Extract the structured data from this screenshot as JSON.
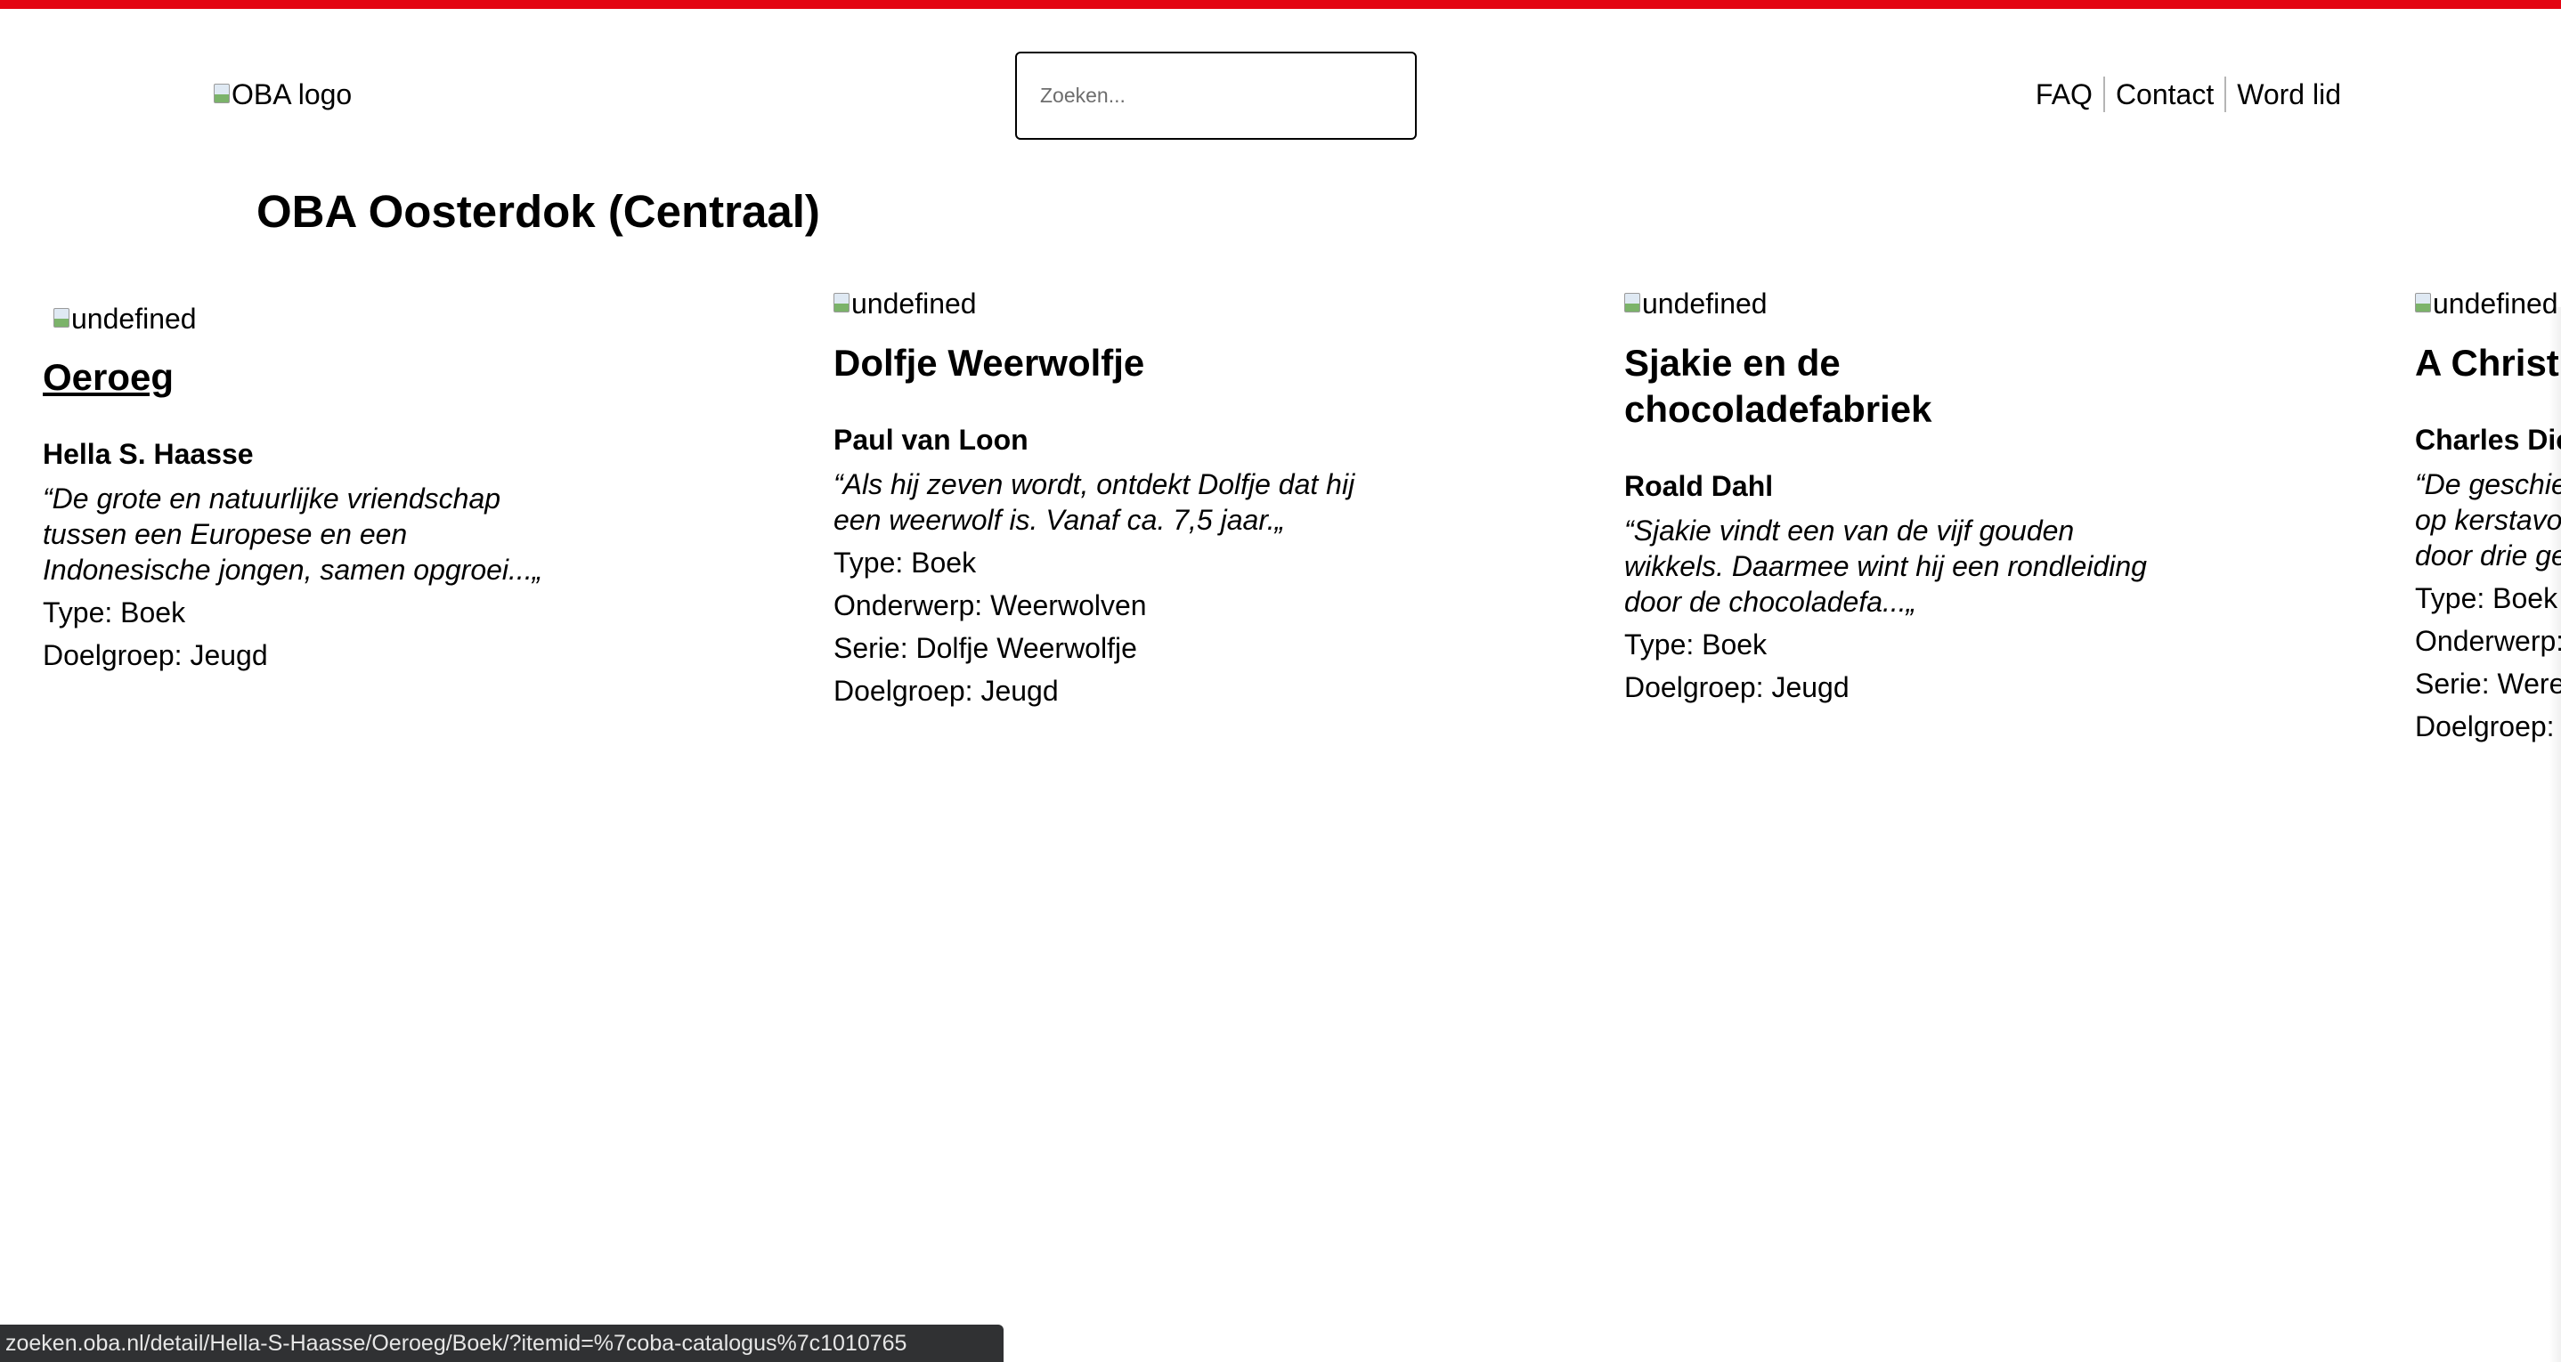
{
  "header": {
    "logo_alt": "OBA logo",
    "search_placeholder": "Zoeken...",
    "nav": [
      {
        "label": "FAQ"
      },
      {
        "label": "Contact"
      },
      {
        "label": "Word lid"
      }
    ]
  },
  "page_title": "OBA Oosterdok (Centraal)",
  "cards": [
    {
      "image_alt": "undefined",
      "title": "Oeroeg",
      "author": "Hella S. Haasse",
      "summary": "“De grote en natuurlijke vriendschap tussen een Europese en een Indonesische jongen, samen opgroei...„",
      "meta": [
        "Type: Boek",
        "Doelgroep: Jeugd"
      ]
    },
    {
      "image_alt": "undefined",
      "title": "Dolfje Weerwolfje",
      "author": "Paul van Loon",
      "summary": "“Als hij zeven wordt, ontdekt Dolfje dat hij een weerwolf is. Vanaf ca. 7,5 jaar.„",
      "meta": [
        "Type: Boek",
        "Onderwerp: Weerwolven",
        "Serie: Dolfje Weerwolfje",
        "Doelgroep: Jeugd"
      ]
    },
    {
      "image_alt": "undefined",
      "title": "Sjakie en de chocoladefabriek",
      "author": "Roald Dahl",
      "summary": "“Sjakie vindt een van de vijf gouden wikkels. Daarmee wint hij een rondleiding door de chocoladefa...„",
      "meta": [
        "Type: Boek",
        "Doelgroep: Jeugd"
      ]
    },
    {
      "image_alt": "undefined",
      "title": "A Christ",
      "author": "Charles Dic",
      "summary_lines": [
        "“De geschie",
        "op kerstavo",
        "door drie ge"
      ],
      "meta": [
        "Type: Boek",
        "Onderwerp:",
        "Serie: Were",
        "Doelgroep:"
      ]
    }
  ],
  "status_bar": {
    "url": "zoeken.oba.nl/detail/Hella-S-Haasse/Oeroeg/Boek/?itemid=%7coba-catalogus%7c1010765"
  }
}
